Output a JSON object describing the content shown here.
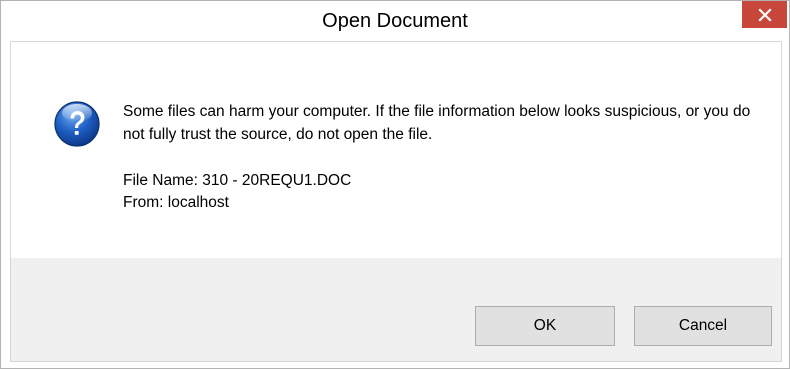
{
  "window": {
    "title": "Open Document",
    "close_symbol": "×",
    "close_color": "#c9463a"
  },
  "dialog": {
    "icon": "question-icon",
    "message": "Some files can harm your computer. If the file information below looks suspicious, or you do not fully trust the source, do not open the file.",
    "file_name_label": "File Name:",
    "file_name_value": "310 - 20REQU1.DOC",
    "from_label": "From:",
    "from_value": "localhost"
  },
  "buttons": {
    "ok_label": "OK",
    "cancel_label": "Cancel"
  }
}
